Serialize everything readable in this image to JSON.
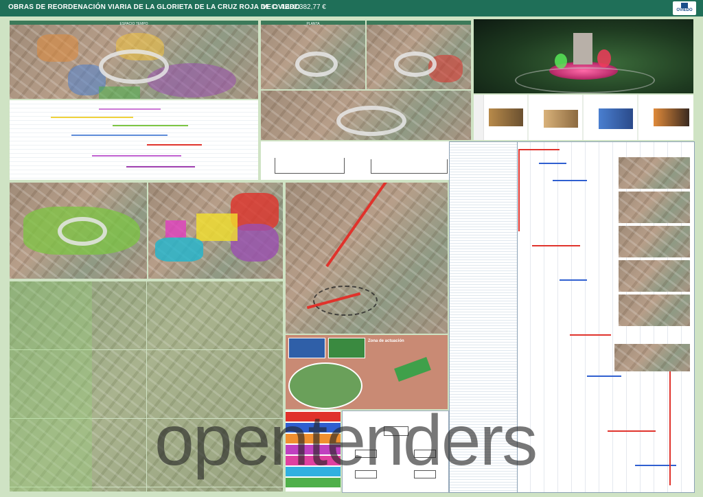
{
  "header": {
    "title": "OBRAS DE REORDENACIÓN VIARIA DE LA GLORIETA DE LA CRUZ ROJA DE OVIEDO",
    "vec": "VEC: 4.482.382,77 €",
    "logo_text": "OVIEDO"
  },
  "panels": {
    "phases_map_label": "ESPACIO TEMPO",
    "plan_label": "PLANTA"
  },
  "location": {
    "label": "Zona de actuación"
  },
  "watermark": "opentenders",
  "colors": {
    "header_bg": "#1f6f58",
    "page_bg": "#cfe3c4",
    "phase_green": "#7cc642",
    "phase_yellow": "#f2e02c",
    "phase_red": "#e0322b",
    "phase_purple": "#9b4fb0",
    "phase_cyan": "#1fb7d0"
  }
}
